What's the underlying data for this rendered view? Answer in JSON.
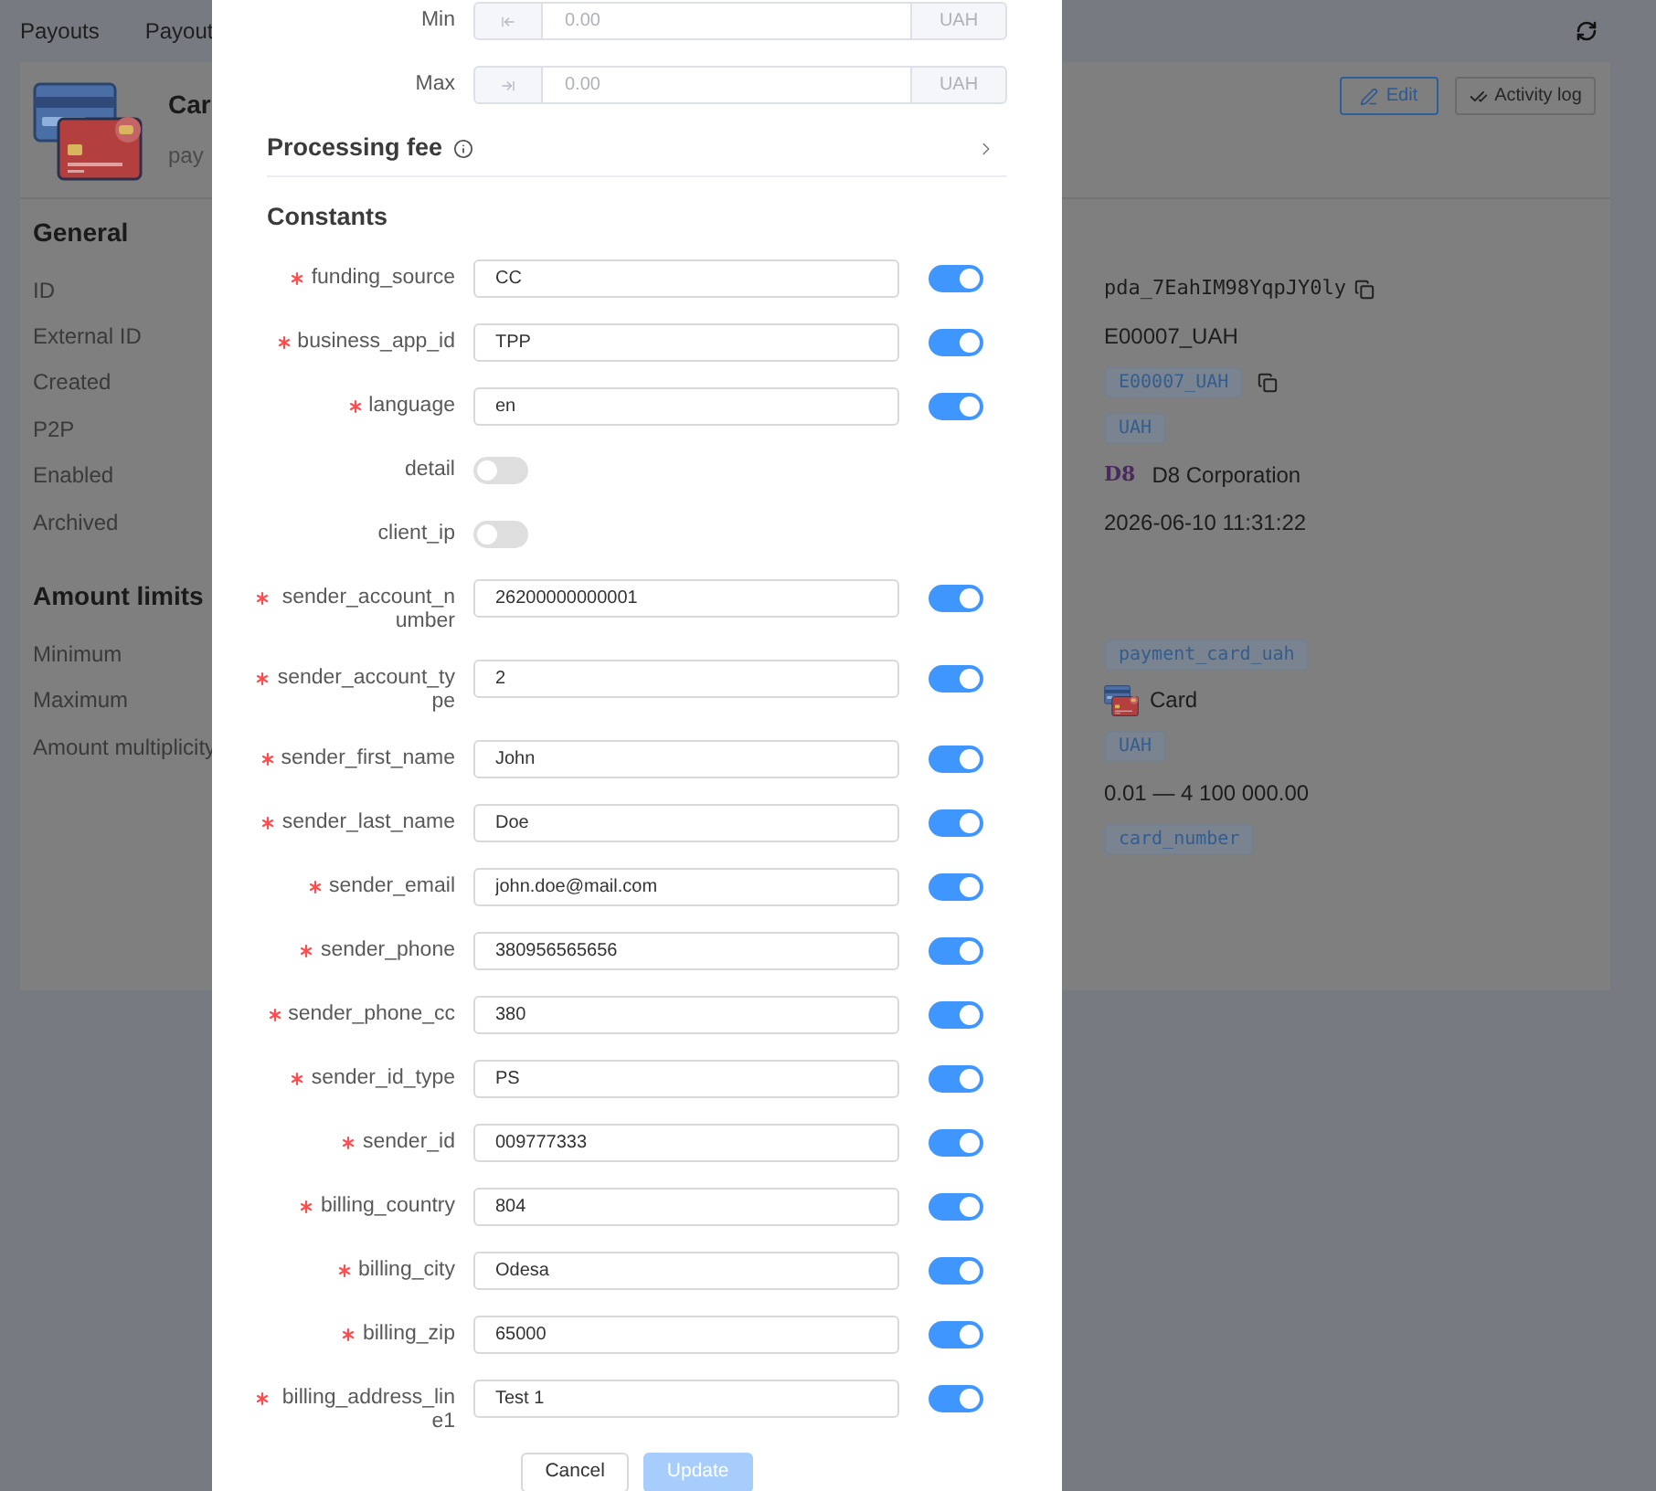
{
  "top_bar": {
    "links": [
      "Payouts",
      "Payout"
    ]
  },
  "header": {
    "title": "Car",
    "subtitle": "pay",
    "buttons": [
      {
        "kind": "edit",
        "label": "Edit"
      },
      {
        "kind": "activity",
        "label": "Activity log"
      }
    ]
  },
  "sections": [
    {
      "title": "General",
      "labels": [
        "ID",
        "External ID",
        "Created",
        "P2P",
        "Enabled",
        "Archived"
      ],
      "values": [
        {
          "kind": "mono_copy",
          "text": "pda_7EahIM98YqpJY0ly"
        },
        {
          "kind": "text",
          "text": "E00007_UAH"
        },
        {
          "kind": "tag_copy",
          "text": "E00007_UAH"
        },
        {
          "kind": "tag",
          "text": "UAH"
        },
        {
          "kind": "company",
          "logo": "D8",
          "text": "D8 Corporation"
        },
        {
          "kind": "text",
          "text": "2026-06-10 11:31:22"
        }
      ]
    },
    {
      "title": "Amount limits",
      "labels": [
        "Minimum",
        "Maximum",
        "Amount multiplicity"
      ],
      "values": [
        {
          "kind": "tag",
          "text": "payment_card_uah"
        },
        {
          "kind": "card",
          "text": "Card"
        },
        {
          "kind": "tag",
          "text": "UAH"
        },
        {
          "kind": "text",
          "text": "0.01 — 4 100 000.00"
        },
        {
          "kind": "tag",
          "text": "card_number"
        }
      ]
    }
  ],
  "modal": {
    "limits": [
      {
        "kind": "min",
        "label": "Min",
        "placeholder": "0.00",
        "currency": "UAH"
      },
      {
        "kind": "max",
        "label": "Max",
        "placeholder": "0.00",
        "currency": "UAH"
      }
    ],
    "processing_fee": {
      "title": "Processing fee",
      "expanded": false
    },
    "constants": {
      "title": "Constants",
      "fields": [
        {
          "kind": "input",
          "name": "funding_source",
          "required": true,
          "value": "CC",
          "on": true
        },
        {
          "kind": "input",
          "name": "business_app_id",
          "required": true,
          "value": "TPP",
          "on": true
        },
        {
          "kind": "input",
          "name": "language",
          "required": true,
          "value": "en",
          "on": true
        },
        {
          "kind": "toggle",
          "name": "detail",
          "required": false,
          "on": false
        },
        {
          "kind": "toggle",
          "name": "client_ip",
          "required": false,
          "on": false
        },
        {
          "kind": "input",
          "name": "sender_account_number",
          "required": true,
          "value": "26200000000001",
          "on": true
        },
        {
          "kind": "input",
          "name": "sender_account_type",
          "required": true,
          "value": "2",
          "on": true
        },
        {
          "kind": "input",
          "name": "sender_first_name",
          "required": true,
          "value": "John",
          "on": true
        },
        {
          "kind": "input",
          "name": "sender_last_name",
          "required": true,
          "value": "Doe",
          "on": true
        },
        {
          "kind": "input",
          "name": "sender_email",
          "required": true,
          "value": "john.doe@mail.com",
          "on": true
        },
        {
          "kind": "input",
          "name": "sender_phone",
          "required": true,
          "value": "380956565656",
          "on": true
        },
        {
          "kind": "input",
          "name": "sender_phone_cc",
          "required": true,
          "value": "380",
          "on": true
        },
        {
          "kind": "input",
          "name": "sender_id_type",
          "required": true,
          "value": "PS",
          "on": true
        },
        {
          "kind": "input",
          "name": "sender_id",
          "required": true,
          "value": "009777333",
          "on": true
        },
        {
          "kind": "input",
          "name": "billing_country",
          "required": true,
          "value": "804",
          "on": true
        },
        {
          "kind": "input",
          "name": "billing_city",
          "required": true,
          "value": "Odesa",
          "on": true
        },
        {
          "kind": "input",
          "name": "billing_zip",
          "required": true,
          "value": "65000",
          "on": true
        },
        {
          "kind": "input",
          "name": "billing_address_line1",
          "required": true,
          "value": "Test 1",
          "on": true
        }
      ]
    },
    "buttons": [
      {
        "kind": "secondary",
        "label": "Cancel",
        "disabled": false
      },
      {
        "kind": "primary",
        "label": "Update",
        "disabled": true
      }
    ]
  }
}
